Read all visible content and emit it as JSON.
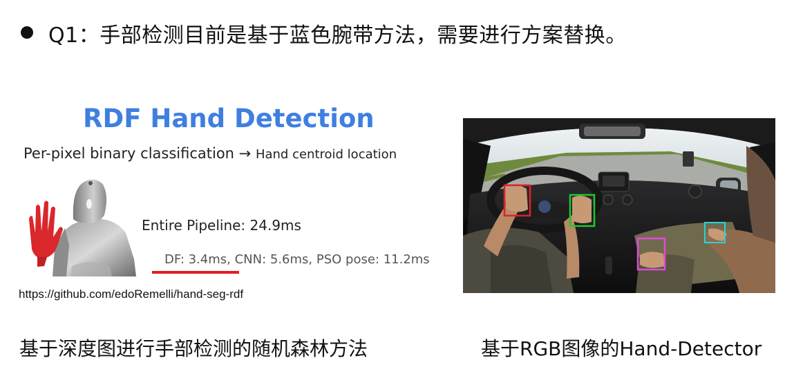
{
  "slide": {
    "heading": "Q1：手部检测目前是基于蓝色腕带方法，需要进行方案替换。"
  },
  "left_panel": {
    "title": "RDF Hand Detection",
    "subtitle_main": "Per-pixel binary classification → ",
    "subtitle_small": "Hand centroid location",
    "pipeline": "Entire Pipeline: 24.9ms",
    "timings": "DF: 3.4ms, CNN: 5.6ms, PSO pose: 11.2ms",
    "link": "https://github.com/edoRemelli/hand-seg-rdf",
    "caption": "基于深度图进行手部检测的随机森林方法"
  },
  "right_panel": {
    "caption": "基于RGB图像的Hand-Detector"
  },
  "colors": {
    "title_blue": "#3f7fe0",
    "underline_red": "#e41c1c",
    "hand_red": "#d9272c"
  }
}
